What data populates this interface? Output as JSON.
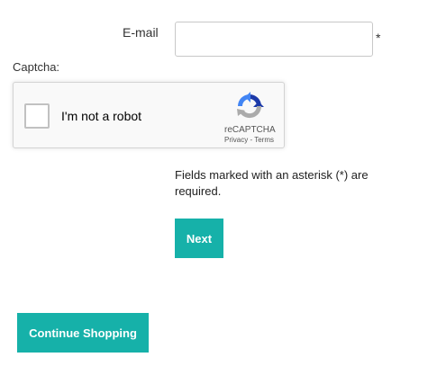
{
  "form": {
    "email_label": "E-mail",
    "email_value": "",
    "required_mark": "*",
    "captcha_label": "Captcha:",
    "required_note": "Fields marked with an asterisk (*) are required."
  },
  "recaptcha": {
    "checkbox_text": "I'm not a robot",
    "brand": "reCAPTCHA",
    "privacy_link": "Privacy",
    "separator": " - ",
    "terms_link": "Terms",
    "icon": "recaptcha-logo-icon",
    "checked": false
  },
  "buttons": {
    "next_label": "Next",
    "continue_label": "Continue Shopping",
    "color": "#16b1a9"
  }
}
